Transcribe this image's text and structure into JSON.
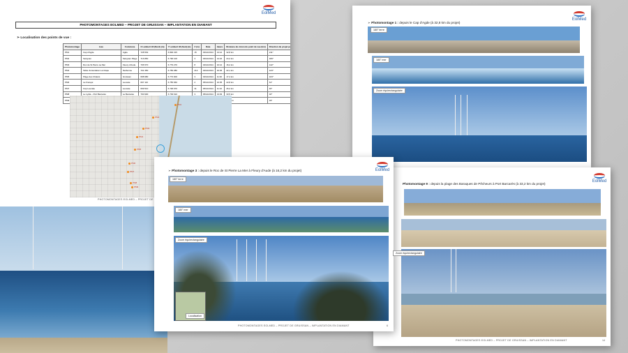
{
  "brand": {
    "logo_text": "EolMed"
  },
  "page1": {
    "header": "PHOTOMONTAGES EOLMED – PROJET DE GRUISSAN – IMPLANTATION EN DIAMANT",
    "section_title": "Localisation des points de vue :",
    "table": {
      "columns": [
        "Photomontage",
        "Lieu",
        "Commune",
        "X Lambert 93 (Nord) (m)",
        "Y Lambert 93 (Sud) (m)",
        "Z (m)",
        "Date",
        "Heure",
        "Distance de vision du point de vue (km)",
        "Direction du projet par rapport au point de vue"
      ],
      "rows": [
        [
          "PM1",
          "Cap d'Agde",
          "Agde",
          "728 563",
          "6 800 315",
          "15",
          "03/12/2014",
          "13:12",
          "32,8 km",
          "211°"
        ],
        [
          "PM2",
          "Sérignan",
          "Sérignan Plage",
          "716 850",
          "6 790 100",
          "3",
          "03/12/2014",
          "14:22",
          "24,2 km",
          "180°"
        ],
        [
          "PM3",
          "Roc de St Pierre La Mer",
          "Fleury d'Aude",
          "706 570",
          "6 779 270",
          "8",
          "04/12/2014",
          "10:12",
          "16,2 km",
          "142°"
        ],
        [
          "PM4",
          "Table d'orientation La Clape",
          "Narbonne",
          "701 350",
          "6 783 380",
          "214",
          "04/12/2014",
          "10:45",
          "22,1 km",
          "123°"
        ],
        [
          "PM5",
          "Plage des Chalets",
          "Gruissan",
          "698 980",
          "6 773 000",
          "3",
          "04/12/2014",
          "11:30",
          "17,4 km",
          "103°"
        ],
        [
          "PM6",
          "La Franqui",
          "Leucate",
          "697 110",
          "6 755 660",
          "2",
          "05/12/2014",
          "10:35",
          "22,8 km",
          "61°"
        ],
        [
          "PM7",
          "Cap Leucate",
          "Leucate",
          "699 510",
          "6 748 970",
          "31",
          "05/12/2014",
          "11:16",
          "26,2 km",
          "46°"
        ],
        [
          "PM8",
          "Le Lydia – Port Barcarès",
          "Le Barcarès",
          "700 900",
          "6 739 610",
          "3",
          "05/12/2014",
          "13:03",
          "33,5 km",
          "32°"
        ],
        [
          "PM9",
          "Baraques de pêcheurs – Port Barcarès",
          "Le Barcarès",
          "701 900",
          "6 741 380",
          "3",
          "05/12/2014",
          "09:45",
          "33,2 km",
          "33°"
        ]
      ]
    },
    "map_labels": [
      "PM1",
      "PM2",
      "PM3",
      "PM4",
      "PM5",
      "PM6",
      "PM7",
      "PM8",
      "PM9"
    ],
    "footer": "PHOTOMONTAGES EOLMED – PROJET DE GRUISSAN"
  },
  "page2": {
    "title_bold": "Photomontage 1 :",
    "title_rest": " depuis le Cap d'Agde (à 32,8 km du projet)",
    "tags": [
      "180° terre",
      "180° mer",
      "Zoom équirectangulaire"
    ]
  },
  "page3": {
    "title_bold": "Photomontage 3 :",
    "title_rest": " depuis le Roc de St Pierre La Mer à Fleury d'Aude (à 16,2 km du projet)",
    "tags": [
      "180° terre",
      "180° mer",
      "Zoom équirectangulaire"
    ],
    "inset_label": "Localisation",
    "footer": "PHOTOMONTAGES EOLMED – PROJET DE GRUISSAN – IMPLANTATION EN DIAMANT",
    "page_number": "6"
  },
  "page4": {
    "title_bold": "Photomontage 9 :",
    "title_rest": " depuis la plage des Baraques de Pêcheurs à Port Barcarès (à 33,2 km du projet)",
    "tags": [
      "Zoom équirectangulaire"
    ],
    "footer": "PHOTOMONTAGES EOLMED – PROJET DE GRUISSAN – IMPLANTATION EN DIAMANT",
    "page_number": "14"
  },
  "colors": {
    "sea": "#2f6fa8",
    "sky": "#8fb6dc",
    "sand": "#c9b89a",
    "brand_blue": "#1f5aa6",
    "brand_red": "#d23a2f"
  }
}
